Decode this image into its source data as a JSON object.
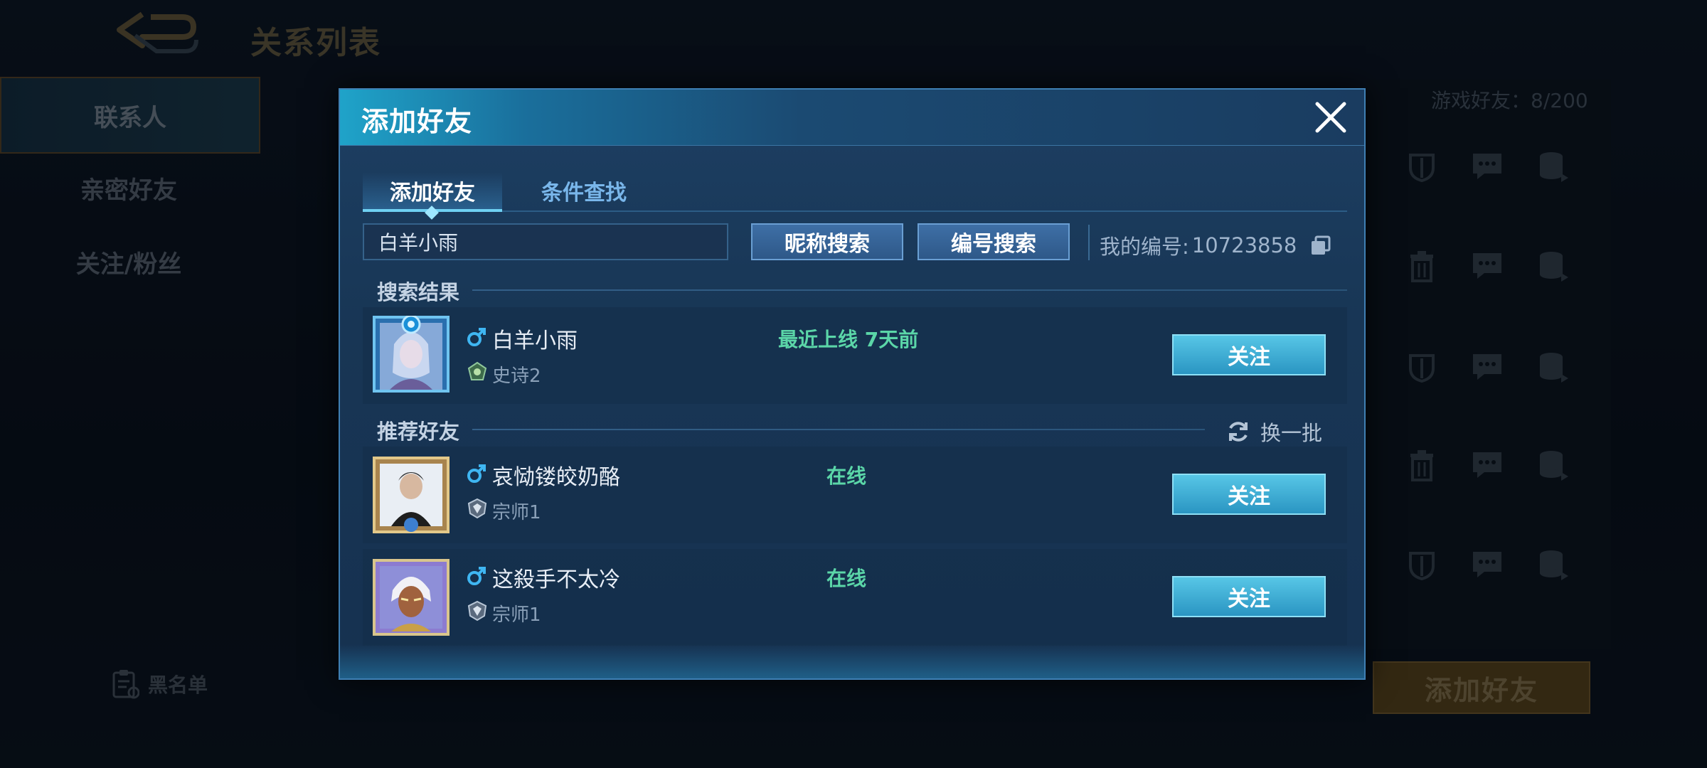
{
  "background": {
    "page_title": "关系列表",
    "sidebar": [
      {
        "label": "联系人",
        "active": true
      },
      {
        "label": "亲密好友",
        "active": false
      },
      {
        "label": "关注/粉丝",
        "active": false
      }
    ],
    "blacklist_label": "黑名单",
    "friend_count": "游戏好友：8/200",
    "add_friend_button": "添加好友"
  },
  "dialog": {
    "title": "添加好友",
    "tabs": [
      {
        "label": "添加好友",
        "active": true
      },
      {
        "label": "条件查找",
        "active": false
      }
    ],
    "search": {
      "value": "白羊小雨",
      "nickname_search_label": "昵称搜索",
      "id_search_label": "编号搜索",
      "my_id_label": "我的编号:",
      "my_id_value": "10723858"
    },
    "search_results_label": "搜索结果",
    "search_results": [
      {
        "name": "白羊小雨",
        "gender": "male",
        "rank": "史诗2",
        "status": "最近上线 7天前",
        "action": "关注"
      }
    ],
    "recommend_label": "推荐好友",
    "refresh_label": "换一批",
    "recommended": [
      {
        "name": "哀恸镂皎奶酪",
        "gender": "male",
        "rank": "宗师1",
        "status": "在线",
        "action": "关注"
      },
      {
        "name": "这殺手不太冷",
        "gender": "male",
        "rank": "宗师1",
        "status": "在线",
        "action": "关注"
      }
    ]
  },
  "colors": {
    "accent_cyan": "#57c6e6",
    "online_green": "#5bd6a8",
    "dialog_bg": "#183655",
    "gold_button": "#5e4a22"
  }
}
